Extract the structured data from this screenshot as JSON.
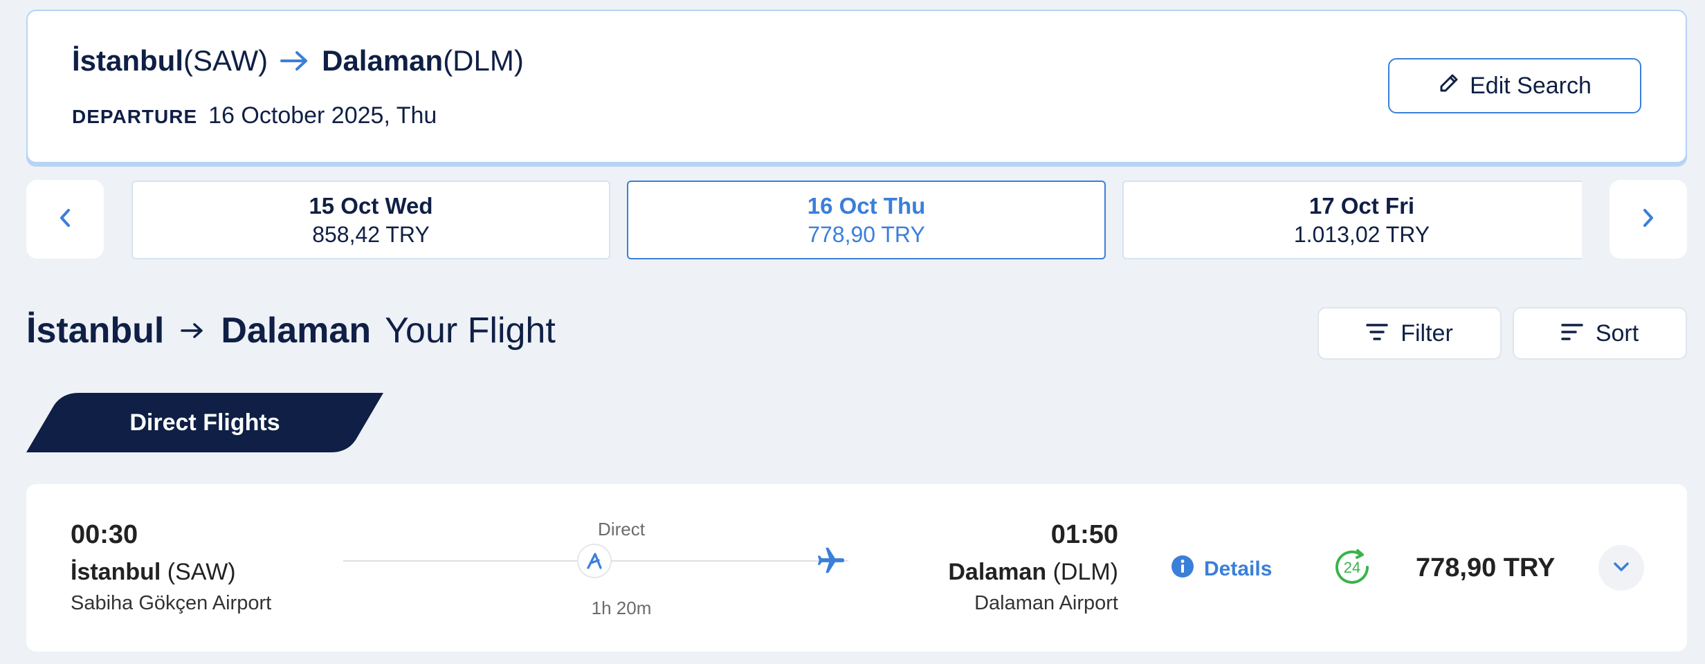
{
  "summary": {
    "origin_city": "İstanbul",
    "origin_code": "(SAW)",
    "destination_city": "Dalaman",
    "destination_code": "(DLM)",
    "departure_label": "DEPARTURE",
    "departure_date": "16 October 2025, Thu",
    "edit_label": "Edit Search"
  },
  "dates": [
    {
      "day": "15 Oct Wed",
      "price": "858,42 TRY",
      "selected": false
    },
    {
      "day": "16 Oct Thu",
      "price": "778,90 TRY",
      "selected": true
    },
    {
      "day": "17 Oct Fri",
      "price": "1.013,02 TRY",
      "selected": false
    }
  ],
  "heading": {
    "from": "İstanbul",
    "to": "Dalaman",
    "subtitle": "Your Flight"
  },
  "toolbar": {
    "filter_label": "Filter",
    "sort_label": "Sort"
  },
  "tab": {
    "label": "Direct Flights"
  },
  "flight": {
    "dep_time": "00:30",
    "dep_city": "İstanbul",
    "dep_code": "(SAW)",
    "dep_airport": "Sabiha Gökçen Airport",
    "stop_label": "Direct",
    "duration": "1h 20m",
    "arr_time": "01:50",
    "arr_city": "Dalaman",
    "arr_code": "(DLM)",
    "arr_airport": "Dalaman Airport",
    "details_label": "Details",
    "badge_text": "24",
    "price": "778,90 TRY"
  },
  "colors": {
    "navy": "#0f1f45",
    "accent": "#3a7fd8",
    "green": "#3bb34a",
    "background": "#eef1f6"
  },
  "icons": [
    "arrow-right-icon",
    "pencil-icon",
    "chevron-left-icon",
    "chevron-right-icon",
    "filter-icon",
    "sort-icon",
    "airline-logo-icon",
    "plane-icon",
    "info-icon",
    "24h-icon",
    "chevron-down-icon"
  ]
}
